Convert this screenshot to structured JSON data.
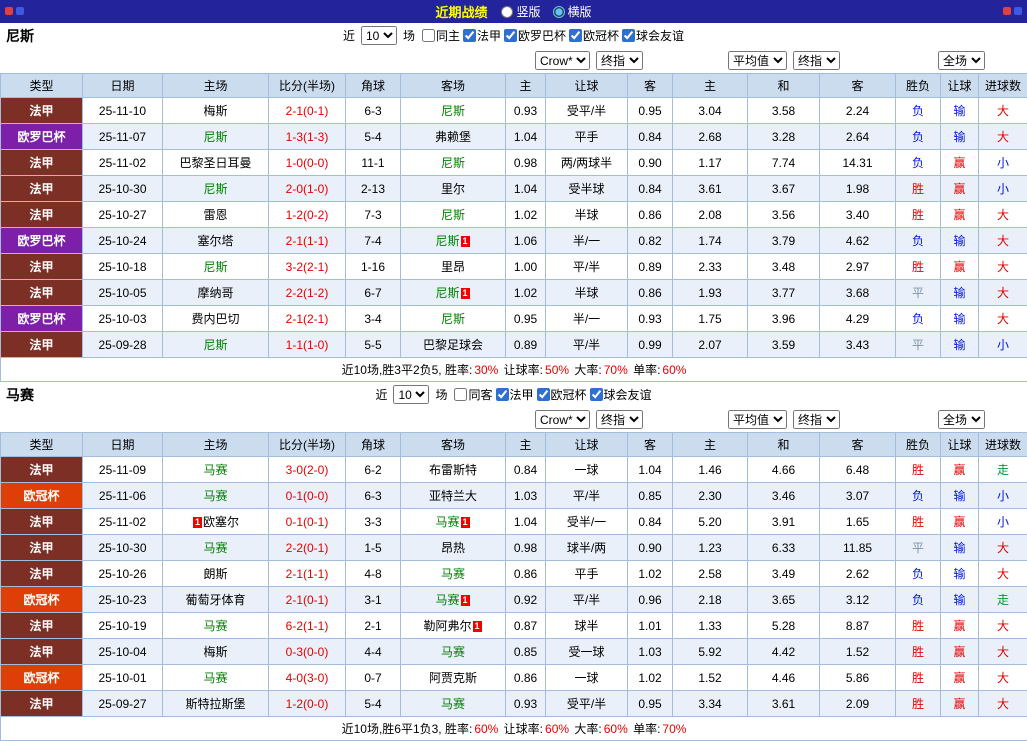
{
  "topbar": {
    "title": "近期战绩",
    "options": [
      {
        "label": "竖版",
        "selected": false
      },
      {
        "label": "横版",
        "selected": true
      }
    ]
  },
  "columns": [
    "类型",
    "日期",
    "主场",
    "比分(半场)",
    "角球",
    "客场",
    "主",
    "让球",
    "客",
    "主",
    "和",
    "客",
    "胜负",
    "让球",
    "进球数"
  ],
  "sections": [
    {
      "team": "尼斯",
      "filter": {
        "prefix": "近",
        "count": "10",
        "suffix": "场",
        "checkboxes": [
          {
            "label": "同主",
            "checked": false
          },
          {
            "label": "法甲",
            "checked": true
          },
          {
            "label": "欧罗巴杯",
            "checked": true
          },
          {
            "label": "欧冠杯",
            "checked": true
          },
          {
            "label": "球会友谊",
            "checked": true
          }
        ]
      },
      "selectors": {
        "asia_company": "Crow*",
        "asia_final": "终指",
        "euro_company": "平均值",
        "euro_final": "终指",
        "scope": "全场"
      },
      "rows": [
        {
          "league": "法甲",
          "date": "25-11-10",
          "home": "梅斯",
          "score": "2-1(0-1)",
          "corner": "6-3",
          "away": "尼斯",
          "a_home": "0.93",
          "a_line": "受平/半",
          "a_away": "0.95",
          "e_home": "3.04",
          "e_draw": "3.58",
          "e_away": "2.24",
          "r_wdl": "负",
          "r_asia": "输",
          "r_goals": "大"
        },
        {
          "league": "欧罗巴杯",
          "date": "25-11-07",
          "home": "尼斯",
          "score": "1-3(1-3)",
          "corner": "5-4",
          "away": "弗赖堡",
          "a_home": "1.04",
          "a_line": "平手",
          "a_away": "0.84",
          "e_home": "2.68",
          "e_draw": "3.28",
          "e_away": "2.64",
          "r_wdl": "负",
          "r_asia": "输",
          "r_goals": "大"
        },
        {
          "league": "法甲",
          "date": "25-11-02",
          "home": "巴黎圣日耳曼",
          "score": "1-0(0-0)",
          "corner": "11-1",
          "away": "尼斯",
          "a_home": "0.98",
          "a_line": "两/两球半",
          "a_away": "0.90",
          "e_home": "1.17",
          "e_draw": "7.74",
          "e_away": "14.31",
          "r_wdl": "负",
          "r_asia": "赢",
          "r_goals": "小"
        },
        {
          "league": "法甲",
          "date": "25-10-30",
          "home": "尼斯",
          "score": "2-0(1-0)",
          "corner": "2-13",
          "away": "里尔",
          "a_home": "1.04",
          "a_line": "受半球",
          "a_away": "0.84",
          "e_home": "3.61",
          "e_draw": "3.67",
          "e_away": "1.98",
          "r_wdl": "胜",
          "r_asia": "赢",
          "r_goals": "小"
        },
        {
          "league": "法甲",
          "date": "25-10-27",
          "home": "雷恩",
          "score": "1-2(0-2)",
          "corner": "7-3",
          "away": "尼斯",
          "a_home": "1.02",
          "a_line": "半球",
          "a_away": "0.86",
          "e_home": "2.08",
          "e_draw": "3.56",
          "e_away": "3.40",
          "r_wdl": "胜",
          "r_asia": "赢",
          "r_goals": "大"
        },
        {
          "league": "欧罗巴杯",
          "date": "25-10-24",
          "home": "塞尔塔",
          "score": "2-1(1-1)",
          "corner": "7-4",
          "away": "尼斯",
          "away_card": "1",
          "a_home": "1.06",
          "a_line": "半/一",
          "a_away": "0.82",
          "e_home": "1.74",
          "e_draw": "3.79",
          "e_away": "4.62",
          "r_wdl": "负",
          "r_asia": "输",
          "r_goals": "大"
        },
        {
          "league": "法甲",
          "date": "25-10-18",
          "home": "尼斯",
          "score": "3-2(2-1)",
          "corner": "1-16",
          "away": "里昂",
          "a_home": "1.00",
          "a_line": "平/半",
          "a_away": "0.89",
          "e_home": "2.33",
          "e_draw": "3.48",
          "e_away": "2.97",
          "r_wdl": "胜",
          "r_asia": "赢",
          "r_goals": "大"
        },
        {
          "league": "法甲",
          "date": "25-10-05",
          "home": "摩纳哥",
          "score": "2-2(1-2)",
          "corner": "6-7",
          "away": "尼斯",
          "away_card": "1",
          "a_home": "1.02",
          "a_line": "半球",
          "a_away": "0.86",
          "e_home": "1.93",
          "e_draw": "3.77",
          "e_away": "3.68",
          "r_wdl": "平",
          "r_asia": "输",
          "r_goals": "大"
        },
        {
          "league": "欧罗巴杯",
          "date": "25-10-03",
          "home": "费内巴切",
          "score": "2-1(2-1)",
          "corner": "3-4",
          "away": "尼斯",
          "a_home": "0.95",
          "a_line": "半/一",
          "a_away": "0.93",
          "e_home": "1.75",
          "e_draw": "3.96",
          "e_away": "4.29",
          "r_wdl": "负",
          "r_asia": "输",
          "r_goals": "大"
        },
        {
          "league": "法甲",
          "date": "25-09-28",
          "home": "尼斯",
          "score": "1-1(1-0)",
          "corner": "5-5",
          "away": "巴黎足球会",
          "a_home": "0.89",
          "a_line": "平/半",
          "a_away": "0.99",
          "e_home": "2.07",
          "e_draw": "3.59",
          "e_away": "3.43",
          "r_wdl": "平",
          "r_asia": "输",
          "r_goals": "小"
        }
      ],
      "summary": [
        {
          "text": "近10场,胜3平2负5, 胜率:",
          "red": false
        },
        {
          "text": "30%",
          "red": true
        },
        {
          "text": " 让球率:",
          "red": false
        },
        {
          "text": "50%",
          "red": true
        },
        {
          "text": " 大率:",
          "red": false
        },
        {
          "text": "70%",
          "red": true
        },
        {
          "text": " 单率:",
          "red": false
        },
        {
          "text": "60%",
          "red": true
        }
      ]
    },
    {
      "team": "马赛",
      "filter": {
        "prefix": "近",
        "count": "10",
        "suffix": "场",
        "checkboxes": [
          {
            "label": "同客",
            "checked": false
          },
          {
            "label": "法甲",
            "checked": true
          },
          {
            "label": "欧冠杯",
            "checked": true
          },
          {
            "label": "球会友谊",
            "checked": true
          }
        ]
      },
      "selectors": {
        "asia_company": "Crow*",
        "asia_final": "终指",
        "euro_company": "平均值",
        "euro_final": "终指",
        "scope": "全场"
      },
      "rows": [
        {
          "league": "法甲",
          "date": "25-11-09",
          "home": "马赛",
          "score": "3-0(2-0)",
          "corner": "6-2",
          "away": "布雷斯特",
          "a_home": "0.84",
          "a_line": "一球",
          "a_away": "1.04",
          "e_home": "1.46",
          "e_draw": "4.66",
          "e_away": "6.48",
          "r_wdl": "胜",
          "r_asia": "赢",
          "r_goals": "走"
        },
        {
          "league": "欧冠杯",
          "date": "25-11-06",
          "home": "马赛",
          "score": "0-1(0-0)",
          "corner": "6-3",
          "away": "亚特兰大",
          "a_home": "1.03",
          "a_line": "平/半",
          "a_away": "0.85",
          "e_home": "2.30",
          "e_draw": "3.46",
          "e_away": "3.07",
          "r_wdl": "负",
          "r_asia": "输",
          "r_goals": "小"
        },
        {
          "league": "法甲",
          "date": "25-11-02",
          "home": "欧塞尔",
          "home_card_pre": "1",
          "score": "0-1(0-1)",
          "corner": "3-3",
          "away": "马赛",
          "away_card": "1",
          "a_home": "1.04",
          "a_line": "受半/一",
          "a_away": "0.84",
          "e_home": "5.20",
          "e_draw": "3.91",
          "e_away": "1.65",
          "r_wdl": "胜",
          "r_asia": "赢",
          "r_goals": "小"
        },
        {
          "league": "法甲",
          "date": "25-10-30",
          "home": "马赛",
          "score": "2-2(0-1)",
          "corner": "1-5",
          "away": "昂热",
          "a_home": "0.98",
          "a_line": "球半/两",
          "a_away": "0.90",
          "e_home": "1.23",
          "e_draw": "6.33",
          "e_away": "11.85",
          "r_wdl": "平",
          "r_asia": "输",
          "r_goals": "大"
        },
        {
          "league": "法甲",
          "date": "25-10-26",
          "home": "朗斯",
          "score": "2-1(1-1)",
          "corner": "4-8",
          "away": "马赛",
          "a_home": "0.86",
          "a_line": "平手",
          "a_away": "1.02",
          "e_home": "2.58",
          "e_draw": "3.49",
          "e_away": "2.62",
          "r_wdl": "负",
          "r_asia": "输",
          "r_goals": "大"
        },
        {
          "league": "欧冠杯",
          "date": "25-10-23",
          "home": "葡萄牙体育",
          "score": "2-1(0-1)",
          "corner": "3-1",
          "away": "马赛",
          "away_card": "1",
          "a_home": "0.92",
          "a_line": "平/半",
          "a_away": "0.96",
          "e_home": "2.18",
          "e_draw": "3.65",
          "e_away": "3.12",
          "r_wdl": "负",
          "r_asia": "输",
          "r_goals": "走"
        },
        {
          "league": "法甲",
          "date": "25-10-19",
          "home": "马赛",
          "score": "6-2(1-1)",
          "corner": "2-1",
          "away": "勒阿弗尔",
          "away_card": "1",
          "a_home": "0.87",
          "a_line": "球半",
          "a_away": "1.01",
          "e_home": "1.33",
          "e_draw": "5.28",
          "e_away": "8.87",
          "r_wdl": "胜",
          "r_asia": "赢",
          "r_goals": "大"
        },
        {
          "league": "法甲",
          "date": "25-10-04",
          "home": "梅斯",
          "score": "0-3(0-0)",
          "corner": "4-4",
          "away": "马赛",
          "a_home": "0.85",
          "a_line": "受一球",
          "a_away": "1.03",
          "e_home": "5.92",
          "e_draw": "4.42",
          "e_away": "1.52",
          "r_wdl": "胜",
          "r_asia": "赢",
          "r_goals": "大"
        },
        {
          "league": "欧冠杯",
          "date": "25-10-01",
          "home": "马赛",
          "score": "4-0(3-0)",
          "corner": "0-7",
          "away": "阿贾克斯",
          "a_home": "0.86",
          "a_line": "一球",
          "a_away": "1.02",
          "e_home": "1.52",
          "e_draw": "4.46",
          "e_away": "5.86",
          "r_wdl": "胜",
          "r_asia": "赢",
          "r_goals": "大"
        },
        {
          "league": "法甲",
          "date": "25-09-27",
          "home": "斯特拉斯堡",
          "score": "1-2(0-0)",
          "corner": "5-4",
          "away": "马赛",
          "a_home": "0.93",
          "a_line": "受平/半",
          "a_away": "0.95",
          "e_home": "3.34",
          "e_draw": "3.61",
          "e_away": "2.09",
          "r_wdl": "胜",
          "r_asia": "赢",
          "r_goals": "大"
        }
      ],
      "summary": [
        {
          "text": "近10场,胜6平1负3, 胜率:",
          "red": false
        },
        {
          "text": "60%",
          "red": true
        },
        {
          "text": " 让球率:",
          "red": false
        },
        {
          "text": "60%",
          "red": true
        },
        {
          "text": " 大率:",
          "red": false
        },
        {
          "text": "60%",
          "red": true
        },
        {
          "text": " 单率:",
          "red": false
        },
        {
          "text": "70%",
          "red": true
        }
      ]
    }
  ]
}
